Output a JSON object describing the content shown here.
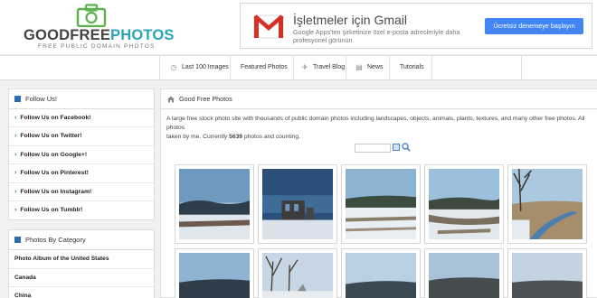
{
  "header": {
    "logo": {
      "title_part1": "GOODFREE",
      "title_part2": "PHOTOS",
      "subtitle": "FREE PUBLIC DOMAIN PHOTOS"
    },
    "ad": {
      "title": "İşletmeler için Gmail",
      "description": "Google Apps'ten şirketinize özel e-posta adresleriyle daha profesyonel görünün",
      "button": "Ücretsiz denemeye başlayın"
    }
  },
  "nav": {
    "items": [
      {
        "label": "Last 100 Images",
        "icon": "clock-icon"
      },
      {
        "label": "Featured Photos",
        "icon": ""
      },
      {
        "label": "Travel Blog",
        "icon": "plane-icon"
      },
      {
        "label": "News",
        "icon": "news-icon"
      },
      {
        "label": "Tutorials",
        "icon": ""
      }
    ]
  },
  "sidebar": {
    "follow": {
      "heading": "Follow Us!",
      "items": [
        "Follow Us on Facebook!",
        "Follow Us on Twitter!",
        "Follow Us on Google+!",
        "Follow Us on Pinterest!",
        "Follow Us on Instagram!",
        "Follow Us on Tumblr!"
      ]
    },
    "categories": {
      "heading": "Photos By Category",
      "items": [
        "Photo Album of the United States",
        "Canada",
        "China"
      ]
    }
  },
  "main": {
    "breadcrumb": "Good Free Photos",
    "intro_line1": "A large free stock photo site with thousands of public domain photos including landscapes, objects, animals, plants, textures, and many other free photos. All photos",
    "intro_line2_prefix": "taken by me. Currently ",
    "intro_count": "5639",
    "intro_line2_suffix": " photos and counting."
  },
  "colors": {
    "accent": "#2ba3bd",
    "link_chevron": "#2e8b3e",
    "ad_button": "#4285f4"
  }
}
